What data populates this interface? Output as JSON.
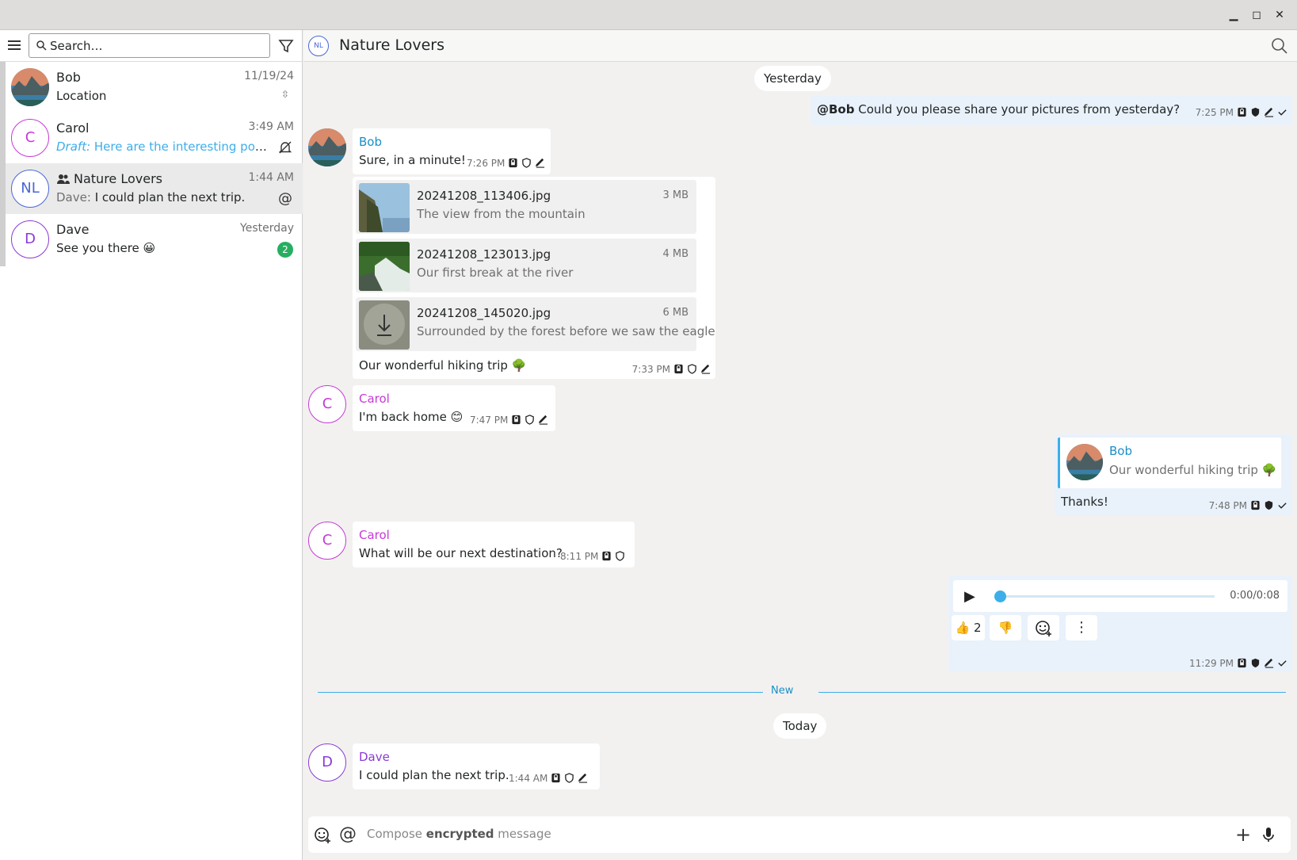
{
  "window": {
    "minimize_icon": "minimize-icon",
    "maximize_icon": "maximize-icon",
    "close_icon": "close-icon"
  },
  "sidebar": {
    "search_placeholder": "Search…",
    "chats": [
      {
        "name": "Bob",
        "time": "11/19/24",
        "preview": "Location",
        "avatar": "photo"
      },
      {
        "name": "Carol",
        "time": "3:49 AM",
        "draft_label": "Draft:",
        "preview": "Here are the interesting podcasts",
        "avatar_initial": "C",
        "avatar_color": "#c63ad6"
      },
      {
        "name": "Nature Lovers",
        "time": "1:44 AM",
        "sender": "Dave:",
        "preview": "I could plan the next trip.",
        "avatar_initial": "NL",
        "avatar_color": "#4a67d6"
      },
      {
        "name": "Dave",
        "time": "Yesterday",
        "preview": "See you there 😀",
        "avatar_initial": "D",
        "avatar_color": "#8a3ad6",
        "unread": "2"
      }
    ]
  },
  "header": {
    "avatar_initial": "NL",
    "title": "Nature Lovers"
  },
  "messages": {
    "day1": "Yesterday",
    "m1": {
      "text_mention": "@Bob",
      "text": " Could you please share your pictures from yesterday?",
      "time": "7:25 PM"
    },
    "m2": {
      "sender": "Bob",
      "text": "Sure, in a minute!",
      "time": "7:26 PM"
    },
    "m3": {
      "files": [
        {
          "name": "20241208_113406.jpg",
          "size": "3 MB",
          "desc": "The view from the mountain"
        },
        {
          "name": "20241208_123013.jpg",
          "size": "4 MB",
          "desc": "Our first break at the river"
        },
        {
          "name": "20241208_145020.jpg",
          "size": "6 MB",
          "desc": "Surrounded by the forest before we saw the eagle"
        }
      ],
      "caption": "Our wonderful hiking trip 🌳",
      "time": "7:33 PM"
    },
    "m4": {
      "sender": "Carol",
      "avatar_initial": "C",
      "text": "I'm back home 😊",
      "time": "7:47 PM"
    },
    "m5": {
      "quote_sender": "Bob",
      "quote_text": "Our wonderful hiking trip 🌳",
      "text": "Thanks!",
      "time": "7:48 PM"
    },
    "m6": {
      "sender": "Carol",
      "avatar_initial": "C",
      "text": "What will be our next destination?",
      "time": "8:11 PM"
    },
    "m7": {
      "audio_time": "0:00/0:08",
      "reaction_thumbs_up": "👍",
      "reaction_count": "2",
      "reaction_thumbs_down": "👎",
      "time": "11:29 PM"
    },
    "new_label": "New",
    "day2": "Today",
    "m8": {
      "sender": "Dave",
      "avatar_initial": "D",
      "text": "I could plan the next trip.",
      "time": "1:44 AM"
    }
  },
  "composer": {
    "placeholder_pre": "Compose ",
    "placeholder_bold": "encrypted",
    "placeholder_post": " message"
  },
  "colors": {
    "accent": "#3daee9",
    "bob": "#1a8fc7",
    "carol": "#c63ad6",
    "dave": "#8a3ad6",
    "unread": "#27ae60"
  }
}
